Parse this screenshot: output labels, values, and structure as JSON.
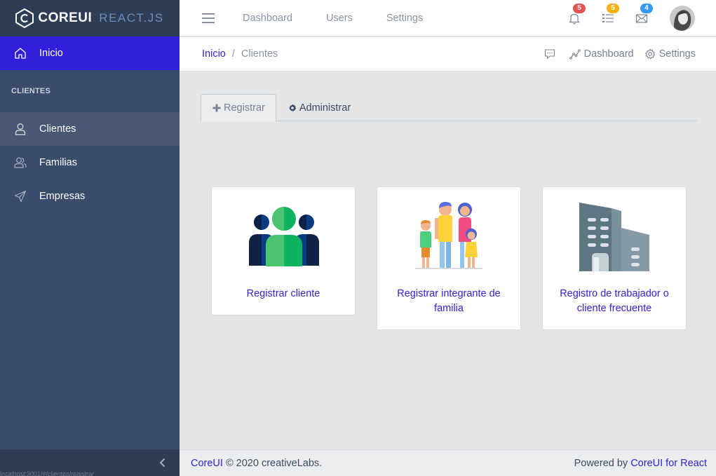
{
  "brand": {
    "core": "COREUI",
    "react": "REACT.JS"
  },
  "sidebar": {
    "active_item": {
      "label": "Inicio",
      "icon": "home-icon"
    },
    "section_title": "CLIENTES",
    "items": [
      {
        "label": "Clientes",
        "icon": "user-icon"
      },
      {
        "label": "Familias",
        "icon": "people-icon"
      },
      {
        "label": "Empresas",
        "icon": "send-icon"
      }
    ],
    "status_text": "localhost:3001/#/clientes/registrar"
  },
  "header": {
    "nav": [
      "Dashboard",
      "Users",
      "Settings"
    ],
    "badges": {
      "notifications": "5",
      "tasks": "5",
      "messages": "4"
    },
    "badge_colors": {
      "notifications": "#e55353",
      "tasks": "#f9b115",
      "messages": "#39f"
    }
  },
  "breadcrumb": {
    "home": "Inicio",
    "separator": "/",
    "current": "Clientes"
  },
  "subheader_actions": {
    "dashboard": "Dashboard",
    "settings": "Settings"
  },
  "tabs": {
    "register": "Registrar",
    "admin": "Administrar"
  },
  "cards": [
    {
      "label": "Registrar cliente",
      "image": "group-icon"
    },
    {
      "label": "Registrar integrante de familia",
      "image": "family-icon"
    },
    {
      "label": "Registro de trabajador o cliente frecuente",
      "image": "building-icon"
    }
  ],
  "footer": {
    "brand_link": "CoreUI",
    "copyright": "© 2020 creativeLabs.",
    "powered_by": "Powered by",
    "powered_link": "CoreUI for React"
  },
  "colors": {
    "primary": "#321fdb",
    "sidebar": "#3a4b6b",
    "sidebar_dark": "#2f3c55"
  }
}
